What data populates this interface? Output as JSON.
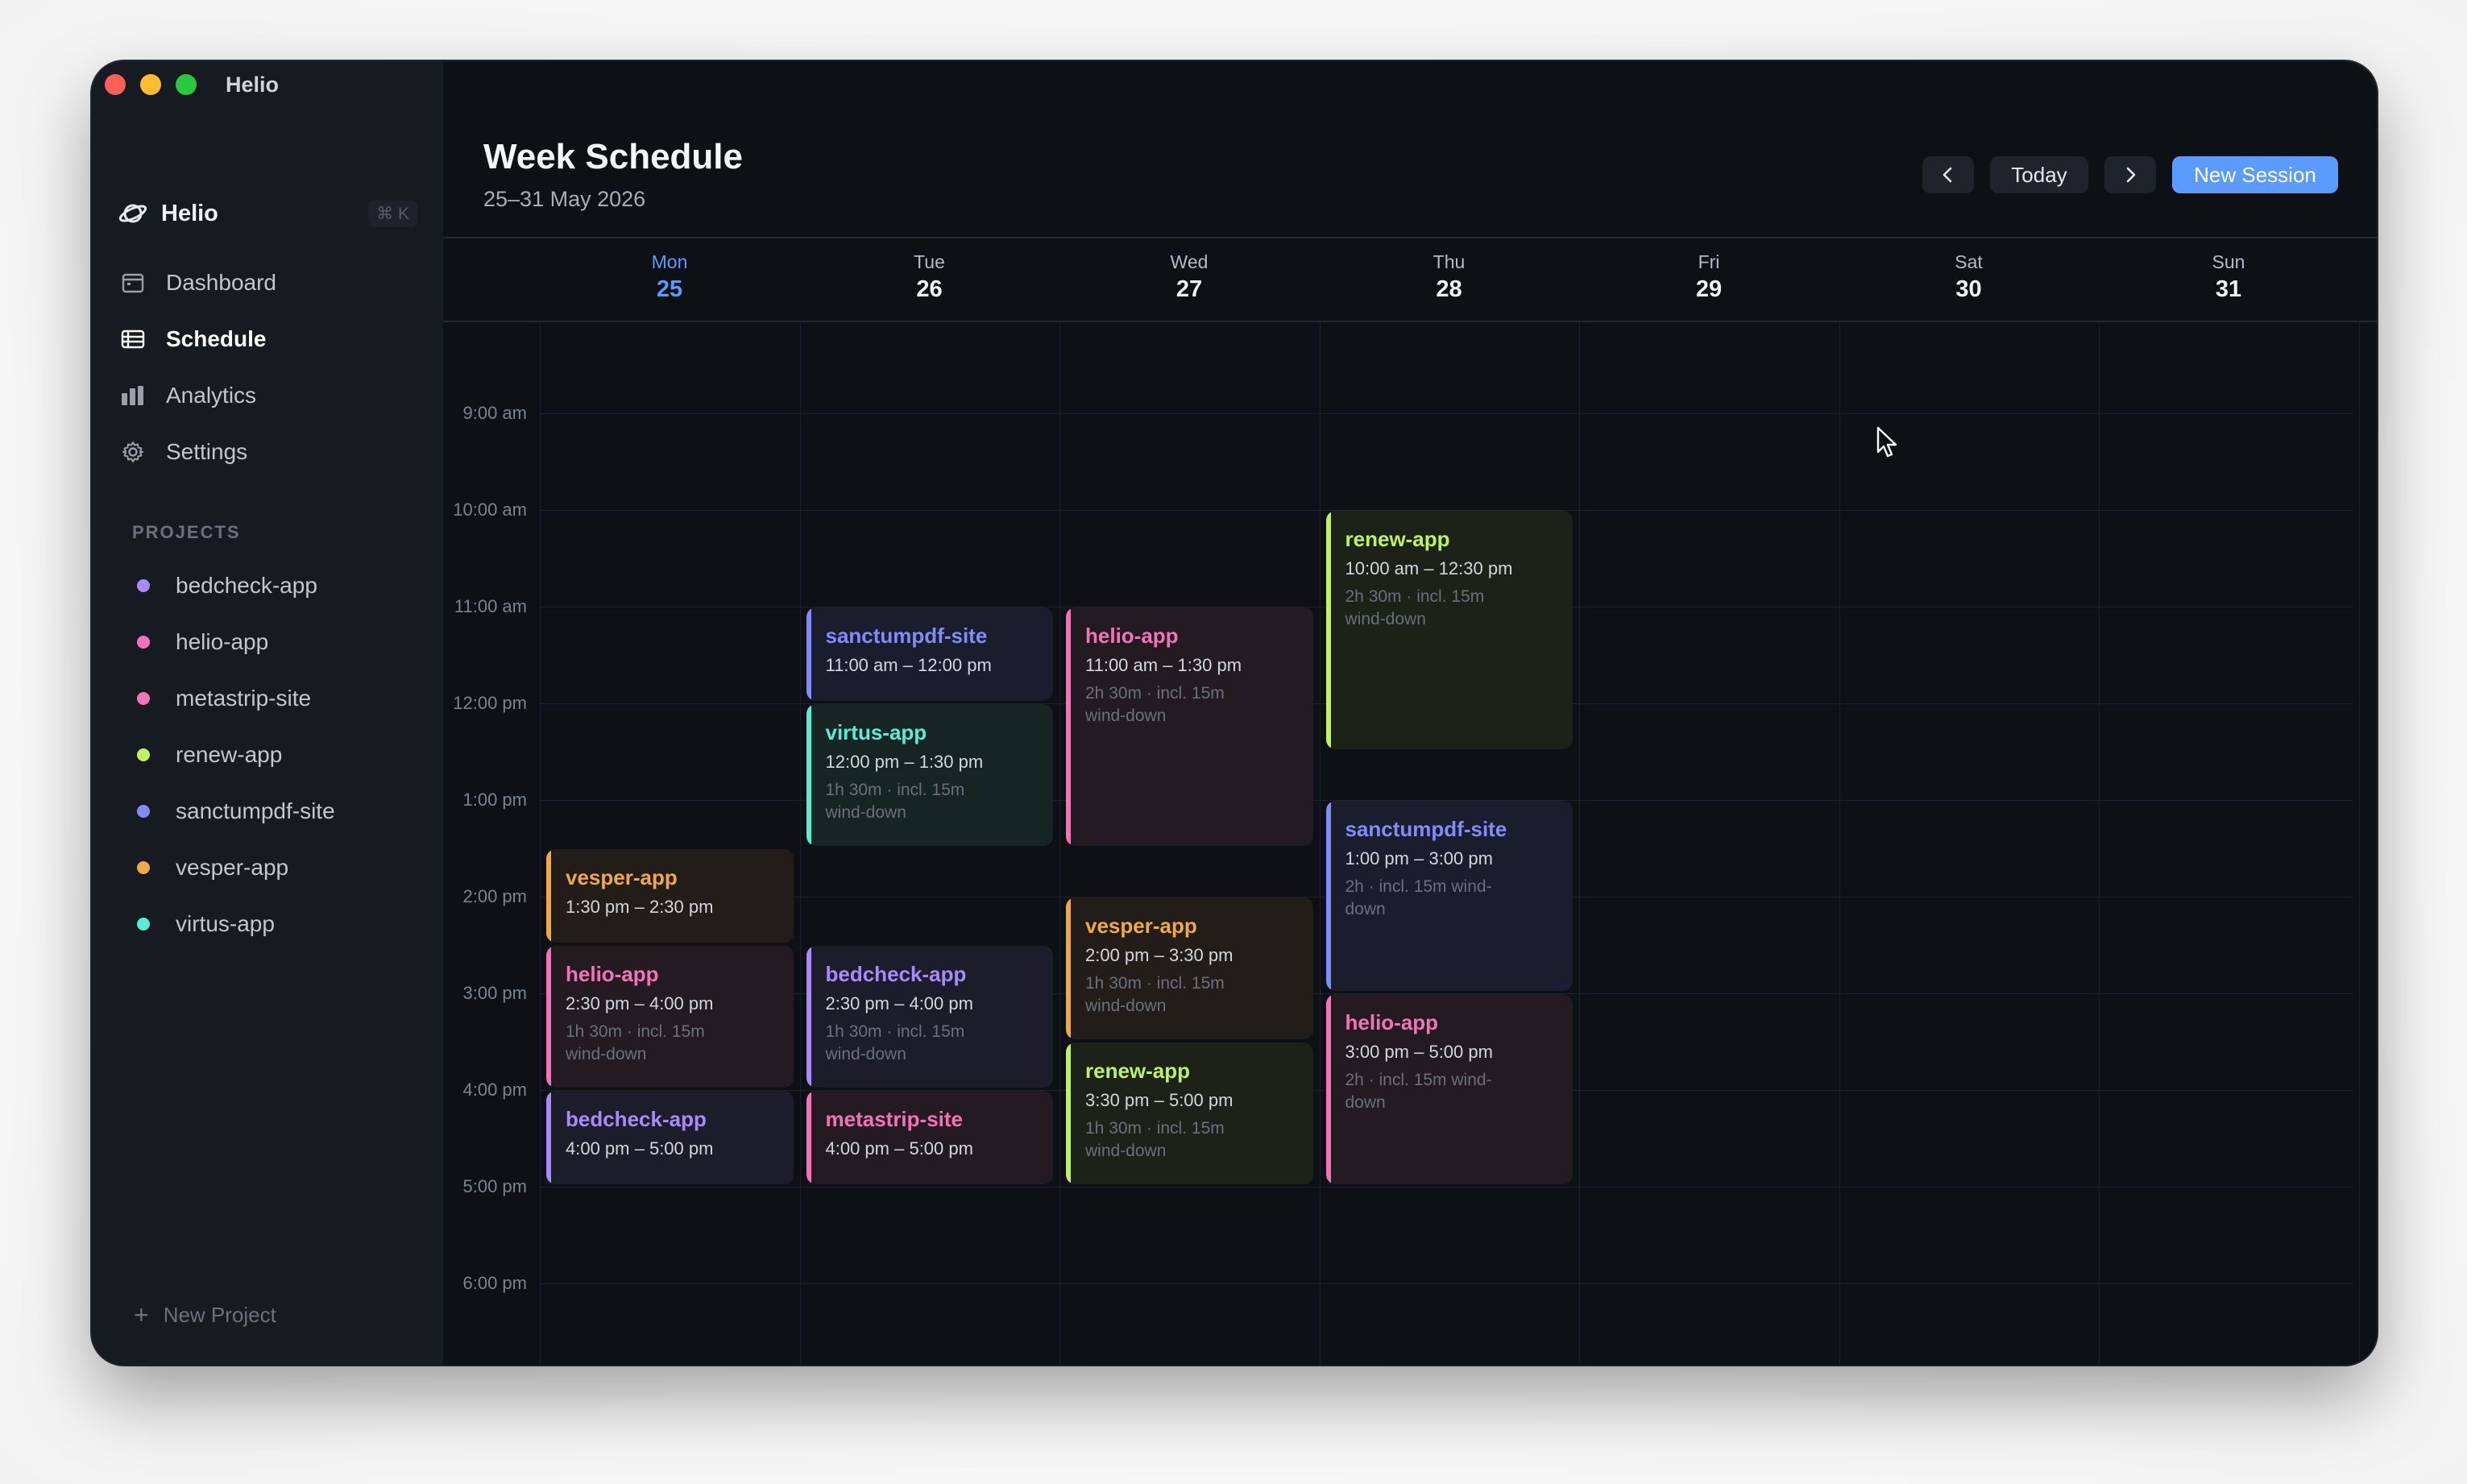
{
  "window": {
    "title": "Helio"
  },
  "sidebar": {
    "brand": {
      "name": "Helio",
      "shortcut": "⌘ K"
    },
    "nav": [
      {
        "label": "Dashboard",
        "icon": "calendar-icon",
        "active": false
      },
      {
        "label": "Schedule",
        "icon": "list-icon",
        "active": true
      },
      {
        "label": "Analytics",
        "icon": "bar-chart-icon",
        "active": false
      },
      {
        "label": "Settings",
        "icon": "gear-icon",
        "active": false
      }
    ],
    "projects_label": "PROJECTS",
    "projects": [
      {
        "label": "bedcheck-app",
        "color": "#a78bfa"
      },
      {
        "label": "helio-app",
        "color": "#f472b6"
      },
      {
        "label": "metastrip-site",
        "color": "#f472b6"
      },
      {
        "label": "renew-app",
        "color": "#bef264"
      },
      {
        "label": "sanctumpdf-site",
        "color": "#818cf8"
      },
      {
        "label": "vesper-app",
        "color": "#f0a94a"
      },
      {
        "label": "virtus-app",
        "color": "#5eead4"
      }
    ],
    "new_project": "New Project"
  },
  "header": {
    "title": "Week Schedule",
    "subtitle": "25–31 May 2026",
    "today_label": "Today",
    "new_session_label": "New Session"
  },
  "days": [
    {
      "name": "Mon",
      "date": "25",
      "today": true
    },
    {
      "name": "Tue",
      "date": "26",
      "today": false
    },
    {
      "name": "Wed",
      "date": "27",
      "today": false
    },
    {
      "name": "Thu",
      "date": "28",
      "today": false
    },
    {
      "name": "Fri",
      "date": "29",
      "today": false
    },
    {
      "name": "Sat",
      "date": "30",
      "today": false
    },
    {
      "name": "Sun",
      "date": "31",
      "today": false
    }
  ],
  "time_labels": [
    "9:00 am",
    "10:00 am",
    "11:00 am",
    "12:00 pm",
    "1:00 pm",
    "2:00 pm",
    "3:00 pm",
    "4:00 pm",
    "5:00 pm",
    "6:00 pm"
  ],
  "events": [
    {
      "day": 0,
      "start": 13.5,
      "end": 14.5,
      "project": "vesper-app",
      "time": "1:30 pm – 2:30 pm",
      "meta": "",
      "color": "#f0a94a",
      "bg": "#221d18"
    },
    {
      "day": 0,
      "start": 14.5,
      "end": 16.0,
      "project": "helio-app",
      "time": "2:30 pm – 4:00 pm",
      "meta": "1h 30m · incl. 15m wind-down",
      "color": "#f472b6",
      "bg": "#231a22"
    },
    {
      "day": 0,
      "start": 16.0,
      "end": 17.0,
      "project": "bedcheck-app",
      "time": "4:00 pm – 5:00 pm",
      "meta": "",
      "color": "#a78bfa",
      "bg": "#1d1c2b"
    },
    {
      "day": 1,
      "start": 11.0,
      "end": 12.0,
      "project": "sanctumpdf-site",
      "time": "11:00 am – 12:00 pm",
      "meta": "",
      "color": "#818cf8",
      "bg": "#1a1d2d"
    },
    {
      "day": 1,
      "start": 12.0,
      "end": 13.5,
      "project": "virtus-app",
      "time": "12:00 pm – 1:30 pm",
      "meta": "1h 30m · incl. 15m wind-down",
      "color": "#5eead4",
      "bg": "#162423"
    },
    {
      "day": 1,
      "start": 14.5,
      "end": 16.0,
      "project": "bedcheck-app",
      "time": "2:30 pm – 4:00 pm",
      "meta": "1h 30m · incl. 15m wind-down",
      "color": "#a78bfa",
      "bg": "#1d1c2b"
    },
    {
      "day": 1,
      "start": 16.0,
      "end": 17.0,
      "project": "metastrip-site",
      "time": "4:00 pm – 5:00 pm",
      "meta": "",
      "color": "#f472b6",
      "bg": "#231a22"
    },
    {
      "day": 2,
      "start": 11.0,
      "end": 13.5,
      "project": "helio-app",
      "time": "11:00 am – 1:30 pm",
      "meta": "2h 30m · incl. 15m wind-down",
      "color": "#f472b6",
      "bg": "#231a22"
    },
    {
      "day": 2,
      "start": 14.0,
      "end": 15.5,
      "project": "vesper-app",
      "time": "2:00 pm – 3:30 pm",
      "meta": "1h 30m · incl. 15m wind-down",
      "color": "#f0a94a",
      "bg": "#221d18"
    },
    {
      "day": 2,
      "start": 15.5,
      "end": 17.0,
      "project": "renew-app",
      "time": "3:30 pm – 5:00 pm",
      "meta": "1h 30m · incl. 15m wind-down",
      "color": "#bef264",
      "bg": "#1c2218"
    },
    {
      "day": 3,
      "start": 10.0,
      "end": 12.5,
      "project": "renew-app",
      "time": "10:00 am – 12:30 pm",
      "meta": "2h 30m · incl. 15m wind-down",
      "color": "#bef264",
      "bg": "#1c2218"
    },
    {
      "day": 3,
      "start": 13.0,
      "end": 15.0,
      "project": "sanctumpdf-site",
      "time": "1:00 pm – 3:00 pm",
      "meta": "2h · incl. 15m wind-down",
      "color": "#818cf8",
      "bg": "#1a1d2d"
    },
    {
      "day": 3,
      "start": 15.0,
      "end": 17.0,
      "project": "helio-app",
      "time": "3:00 pm – 5:00 pm",
      "meta": "2h · incl. 15m wind-down",
      "color": "#f472b6",
      "bg": "#231a22"
    }
  ]
}
